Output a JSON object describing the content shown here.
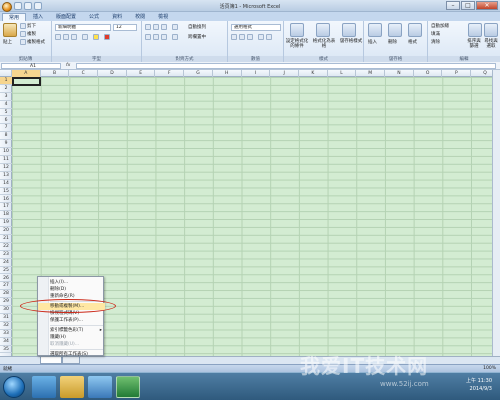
{
  "window": {
    "title": "活頁簿1 - Microsoft Excel"
  },
  "tabs": [
    "常用",
    "插入",
    "版面配置",
    "公式",
    "資料",
    "校閱",
    "檢視"
  ],
  "ribbon": {
    "clipboard": {
      "paste": "貼上",
      "cut": "剪下",
      "copy": "複製",
      "format_painter": "複製格式",
      "label": "剪貼簿"
    },
    "font": {
      "name": "新細明體",
      "size": "12",
      "label": "字型"
    },
    "alignment": {
      "wrap": "自動換列",
      "merge": "跨欄置中",
      "label": "對齊方式"
    },
    "number": {
      "format": "通用格式",
      "label": "數值"
    },
    "styles": {
      "conditional": "設定格式化的條件",
      "table": "格式化為表格",
      "cell": "儲存格樣式",
      "label": "樣式"
    },
    "cells": {
      "insert": "插入",
      "delete": "刪除",
      "format": "格式",
      "label": "儲存格"
    },
    "editing": {
      "autosum": "自動加總",
      "fill": "填滿",
      "clear": "清除",
      "sort": "排序與篩選",
      "find": "尋找與選取",
      "label": "編輯"
    }
  },
  "formula_bar": {
    "name_box": "A1",
    "fx": "fx"
  },
  "columns": [
    "A",
    "B",
    "C",
    "D",
    "E",
    "F",
    "G",
    "H",
    "I",
    "J",
    "K",
    "L",
    "M",
    "N",
    "O",
    "P",
    "Q"
  ],
  "rows": [
    "1",
    "2",
    "3",
    "4",
    "5",
    "6",
    "7",
    "8",
    "9",
    "10",
    "11",
    "12",
    "13",
    "14",
    "15",
    "16",
    "17",
    "18",
    "19",
    "20",
    "21",
    "22",
    "23",
    "24",
    "25",
    "26",
    "27",
    "28",
    "29",
    "30",
    "31",
    "32",
    "33",
    "34",
    "35"
  ],
  "context_menu": {
    "items": [
      {
        "label": "插入(I)...",
        "disabled": false
      },
      {
        "label": "刪除(D)",
        "disabled": false
      },
      {
        "label": "重新命名(R)",
        "disabled": false
      },
      {
        "label": "移動或複製(M)...",
        "disabled": false,
        "highlight": true
      },
      {
        "label": "檢視程式碼(V)",
        "disabled": false
      },
      {
        "label": "保護工作表(P)...",
        "disabled": false
      },
      {
        "label": "索引標籤色彩(T)",
        "disabled": false,
        "submenu": true
      },
      {
        "label": "隱藏(H)",
        "disabled": false
      },
      {
        "label": "取消隱藏(U)...",
        "disabled": true
      },
      {
        "label": "選取所有工作表(S)",
        "disabled": false
      }
    ]
  },
  "status": {
    "text": "就緒",
    "zoom": "100%"
  },
  "taskbar": {
    "time": "上午 11:30",
    "date": "2014/9/3"
  },
  "watermark": {
    "main": "我爱IT技术网",
    "sub": "www.52ij.com"
  },
  "colors": {
    "grid_bg": "#d3ecd2",
    "ribbon": "#dbe7f5",
    "highlight_oval": "#cc2a1a"
  }
}
